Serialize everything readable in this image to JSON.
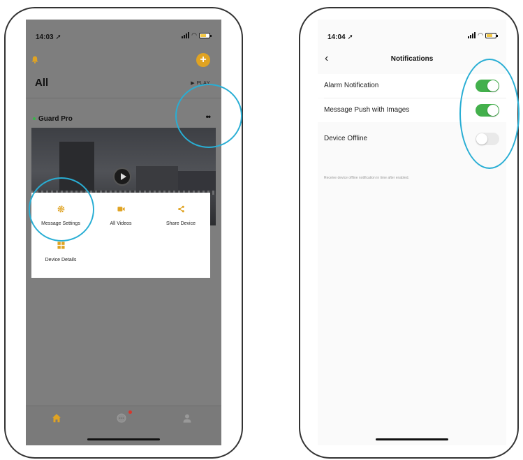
{
  "left_phone": {
    "status_time": "14:03",
    "header_title": "All",
    "play_link": "▶ PLAY",
    "device_name": "Guard Pro",
    "more_label": "••",
    "menu_items": [
      {
        "label": "Message Settings",
        "icon": "gear-icon"
      },
      {
        "label": "All Videos",
        "icon": "video-camera-icon"
      },
      {
        "label": "Share Device",
        "icon": "share-icon"
      },
      {
        "label": "Device Details",
        "icon": "grid-icon"
      }
    ],
    "tabs": [
      {
        "icon": "home-icon",
        "active": true
      },
      {
        "icon": "message-icon",
        "badge": true
      },
      {
        "icon": "profile-icon"
      }
    ],
    "accent_color": "#e0a322"
  },
  "right_phone": {
    "status_time": "14:04",
    "title": "Notifications",
    "settings": [
      {
        "label": "Alarm Notification",
        "enabled": true
      },
      {
        "label": "Message Push with Images",
        "enabled": true
      },
      {
        "label": "Device Offline",
        "enabled": false
      }
    ],
    "hint": "Receive device offline notification in time after enabled.",
    "toggle_on_color": "#43b04c"
  },
  "highlight_color": "#29aed4"
}
